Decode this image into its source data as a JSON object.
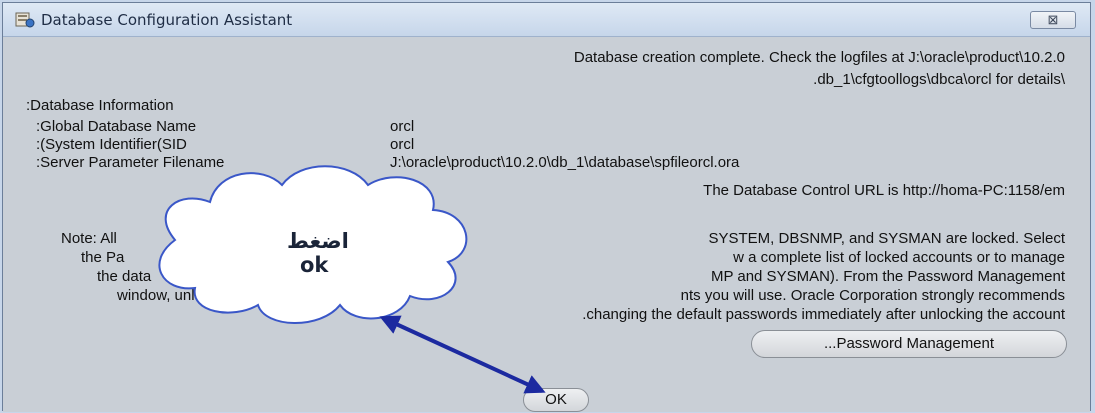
{
  "window": {
    "title": "Database Configuration Assistant",
    "close_glyph": "⊠"
  },
  "messages": {
    "completion_line1": "Database creation complete. Check the logfiles at J:\\oracle\\product\\10.2.0",
    "completion_line2": ".db_1\\cfgtoollogs\\dbca\\orcl for details\\"
  },
  "db_info": {
    "heading": ":Database Information",
    "rows": [
      {
        "label": ":Global Database Name",
        "value": "orcl"
      },
      {
        "label": ":(System Identifier(SID",
        "value": "orcl"
      },
      {
        "label": ":Server Parameter Filename",
        "value": "J:\\oracle\\product\\10.2.0\\db_1\\database\\spfileorcl.ora"
      }
    ]
  },
  "control_url": "The Database Control URL is http://homa-PC:1158/em",
  "note": {
    "line1_start": "Note: All",
    "line1_end": "SYSTEM, DBSNMP, and SYSMAN are locked. Select",
    "line2_start": "the Pa",
    "line2_end": "w a complete list of locked accounts or to manage",
    "line3_start": "the data",
    "line3_end": "MP and SYSMAN). From the Password Management",
    "line4_start": "window, unlock",
    "line4_end": "nts you will use. Oracle Corporation strongly recommends",
    "line5": ".changing the default passwords immediately after unlocking the account"
  },
  "buttons": {
    "password_management": "...Password Management",
    "ok": "OK"
  },
  "annotation": {
    "arabic": "اضغط",
    "ok": "ok",
    "arrow_color": "#1c2aa0"
  }
}
